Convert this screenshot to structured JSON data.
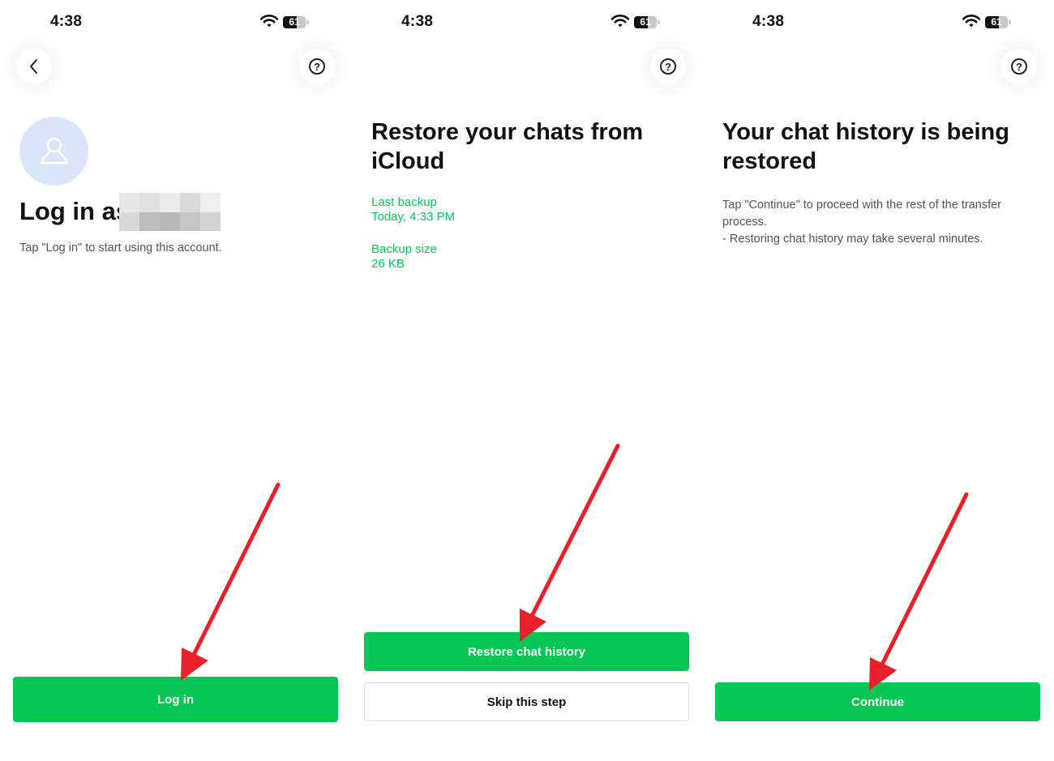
{
  "status_bar": {
    "time": "4:38",
    "battery": "61",
    "battery_level_percent": 61
  },
  "screen1": {
    "title": "Log in as",
    "subtitle": "Tap \"Log in\" to start using this account.",
    "login_button": "Log in"
  },
  "screen2": {
    "title": "Restore your chats from iCloud",
    "last_backup_label": "Last backup",
    "last_backup_value": "Today, 4:33 PM",
    "backup_size_label": "Backup size",
    "backup_size_value": "26 KB",
    "restore_button": "Restore chat history",
    "skip_button": "Skip this step"
  },
  "screen3": {
    "title": "Your chat history is being restored",
    "description": "Tap \"Continue\" to proceed with the rest of the transfer process.",
    "note": "- Restoring chat history may take several minutes.",
    "continue_button": "Continue"
  },
  "icons": [
    "wifi-icon",
    "battery-icon",
    "back-icon",
    "help-icon",
    "user-icon",
    "arrow-annotation"
  ],
  "colors": {
    "accent_green": "#06c755",
    "avatar_bg": "#dce6fb",
    "annotation_red": "#e8202a",
    "text": "#111111",
    "muted": "#555555"
  }
}
